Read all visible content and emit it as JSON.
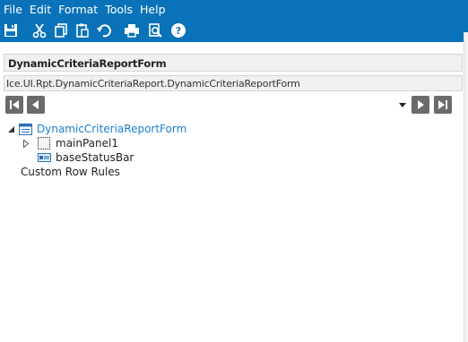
{
  "menu": [
    "File",
    "Edit",
    "Format",
    "Tools",
    "Help"
  ],
  "toolbar": [
    {
      "icon": "save-icon"
    },
    {
      "icon": "cut-icon"
    },
    {
      "icon": "copy-icon"
    },
    {
      "icon": "paste-icon"
    },
    {
      "icon": "undo-icon"
    },
    {
      "icon": "print-icon"
    },
    {
      "icon": "print-preview-icon"
    },
    {
      "icon": "help-icon"
    }
  ],
  "form": {
    "title": "DynamicCriteriaReportForm",
    "path": "Ice.UI.Rpt.DynamicCriteriaReport.DynamicCriteriaReportForm"
  },
  "tree": {
    "root": {
      "label": "DynamicCriteriaReportForm",
      "icon": "form-icon",
      "expanded": true
    },
    "children": [
      {
        "label": "mainPanel1",
        "icon": "panel-icon",
        "expandable": true
      },
      {
        "label": "baseStatusBar",
        "icon": "statusbar-icon",
        "expandable": false
      }
    ],
    "extra": {
      "label": "Custom Row Rules"
    }
  },
  "colors": {
    "topbar": "#0a72b8",
    "root_link": "#1a7fd0",
    "nav_button": "#6b6b6b"
  }
}
